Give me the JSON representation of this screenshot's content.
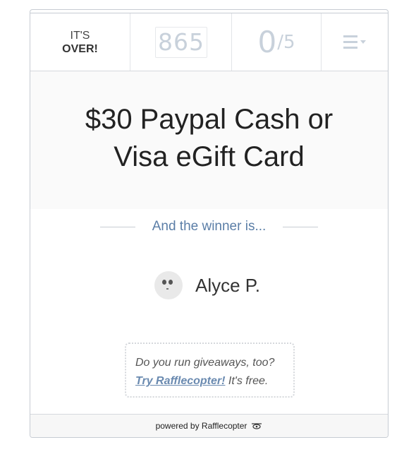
{
  "header": {
    "status_line1": "IT'S",
    "status_line2": "OVER!",
    "countdown_digits": [
      "8",
      "6",
      "5"
    ],
    "entries_count": "0",
    "entries_total": "/5"
  },
  "prize": {
    "title": "$30 Paypal Cash or Visa eGift Card"
  },
  "winner": {
    "heading": "And the winner is...",
    "name": "Alyce P."
  },
  "promo": {
    "question": "Do you run giveaways, too?",
    "link_text": "Try Rafflecopter!",
    "suffix": " It's free."
  },
  "footer": {
    "text": "powered by Rafflecopter"
  },
  "icons": {
    "menu": "hamburger-menu-icon",
    "footer_logo": "rafflecopter-logo-icon",
    "avatar": "default-avatar-icon"
  },
  "colors": {
    "accent_blue": "#5b7ea7",
    "link_blue": "#6a8ab0",
    "muted_gray": "#c8d1db"
  }
}
